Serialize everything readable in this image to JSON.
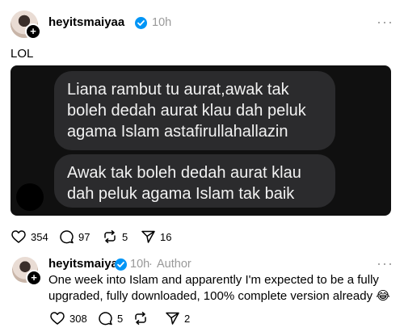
{
  "post": {
    "username": "heyitsmaiyaa",
    "time": "10h",
    "more": "···",
    "caption": "LOL",
    "messages": [
      "Liana rambut tu aurat,awak tak boleh dedah aurat klau dah peluk agama Islam astafirullahallazin",
      "Awak tak boleh dedah aurat klau dah peluk agama Islam tak baik"
    ],
    "actions": {
      "likes": "354",
      "comments": "97",
      "reposts": "5",
      "shares": "16"
    }
  },
  "reply": {
    "username": "heyitsmaiyaa",
    "time": "10h",
    "separator": "·",
    "badge": "Author",
    "more": "···",
    "text": "One week into Islam and apparently I'm expected to be a fully upgraded, fully downloaded, 100% complete version already 😂",
    "actions": {
      "likes": "308",
      "comments": "5",
      "reposts": "",
      "shares": "2"
    }
  },
  "colors": {
    "verified": "#0095f6",
    "muted": "#999999",
    "media_bg": "#101010",
    "bubble": "#2b2b2d"
  }
}
